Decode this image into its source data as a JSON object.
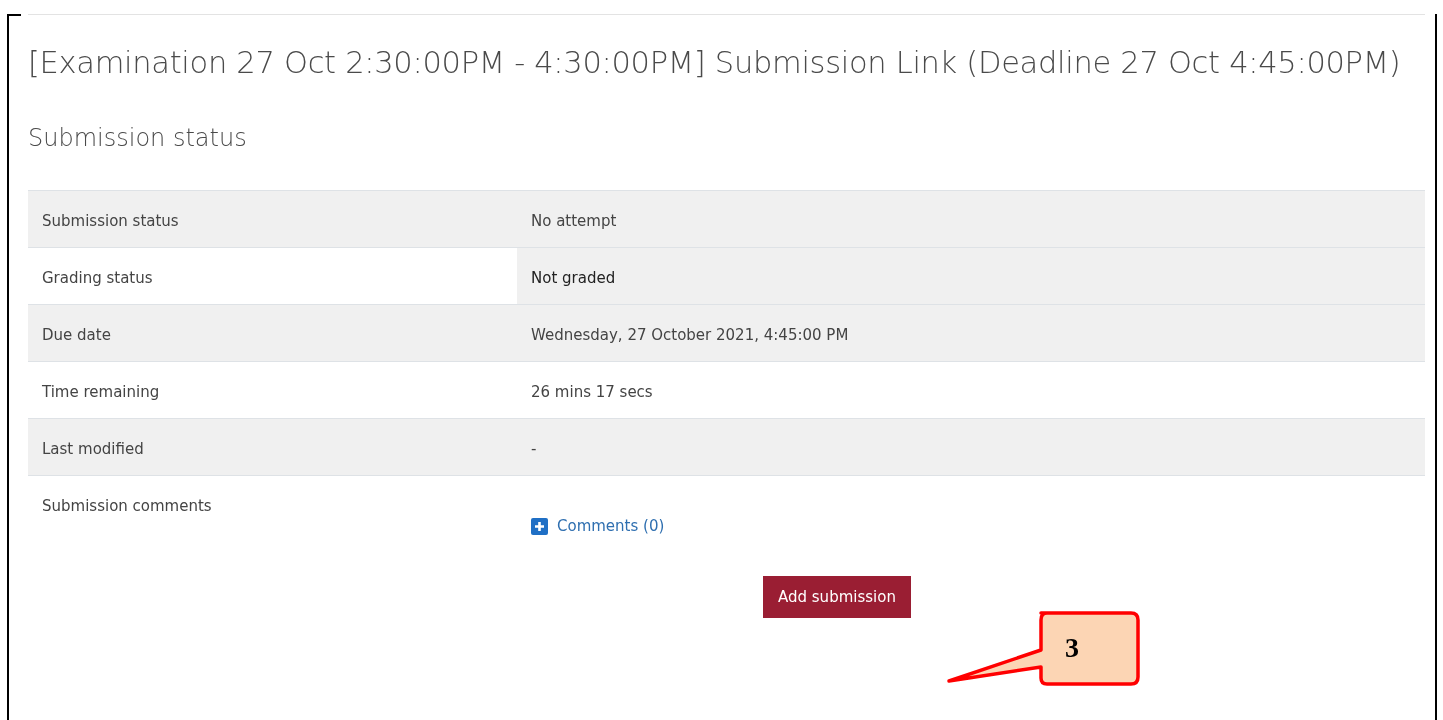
{
  "title": "[Examination 27 Oct 2:30:00PM - 4:30:00PM] Submission Link (Deadline 27 Oct 4:45:00PM)",
  "section_heading": "Submission status",
  "status_rows": [
    {
      "kind": "text",
      "label": "Submission status",
      "value": "No attempt",
      "highlighted": false
    },
    {
      "kind": "text",
      "label": "Grading status",
      "value": "Not graded",
      "highlighted": true
    },
    {
      "kind": "text",
      "label": "Due date",
      "value": "Wednesday, 27 October 2021, 4:45:00 PM",
      "highlighted": false
    },
    {
      "kind": "text",
      "label": "Time remaining",
      "value": "26 mins 17 secs",
      "highlighted": false
    },
    {
      "kind": "text",
      "label": "Last modified",
      "value": "-",
      "highlighted": false
    },
    {
      "kind": "comments",
      "label": "Submission comments",
      "value": "Comments (0)",
      "highlighted": false
    }
  ],
  "button": "Add submission",
  "callout": "3"
}
